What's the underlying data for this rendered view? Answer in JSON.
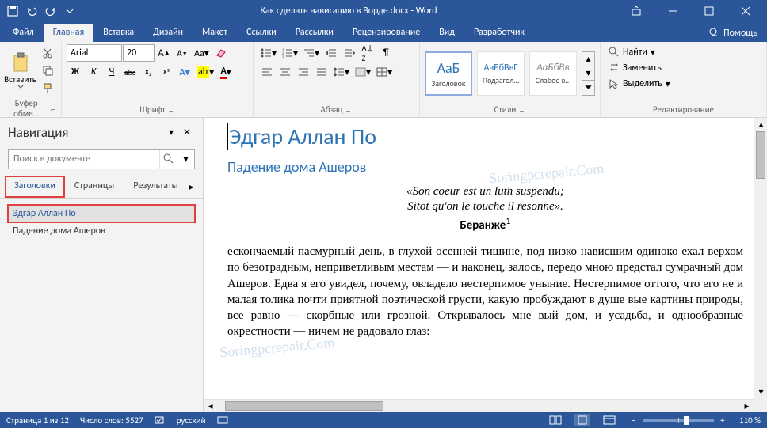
{
  "titlebar": {
    "doc_title": "Как сделать навигацию в Ворде.docx - Word"
  },
  "tabs": {
    "file": "Файл",
    "home": "Главная",
    "insert": "Вставка",
    "design": "Дизайн",
    "layout": "Макет",
    "references": "Ссылки",
    "mailings": "Рассылки",
    "review": "Рецензирование",
    "view": "Вид",
    "developer": "Разработчик",
    "help": "Помощь"
  },
  "ribbon": {
    "clipboard": {
      "paste": "Вставить",
      "label": "Буфер обме…"
    },
    "font": {
      "name": "Arial",
      "size": "20",
      "label": "Шрифт",
      "bold": "Ж",
      "italic": "К",
      "underline": "Ч",
      "strike": "abc"
    },
    "paragraph": {
      "label": "Абзац"
    },
    "styles": {
      "preview1": "АаБ",
      "name1": "Заголовок",
      "preview2": "АаБбВвГ",
      "name2": "Подзагол…",
      "preview3": "АаБбВв",
      "name3": "Слабое в…",
      "label": "Стили"
    },
    "editing": {
      "find": "Найти",
      "replace": "Заменить",
      "select": "Выделить",
      "label": "Редактирование"
    }
  },
  "nav": {
    "title": "Навигация",
    "search_placeholder": "Поиск в документе",
    "tabs": {
      "headings": "Заголовки",
      "pages": "Страницы",
      "results": "Результаты"
    },
    "items": {
      "0": "Эдгар Аллан По",
      "1": "Падение дома Ашеров"
    }
  },
  "doc": {
    "h1": "Эдгар Аллан По",
    "h2": "Падение дома Ашеров",
    "quote1": "«Son coeur est un luth suspendu;",
    "quote2": "Sitot qu'on le touche il resonne».",
    "attrib": "Беранже",
    "attrib_note": "1",
    "body": "ескончаемый пасмурный день, в глухой осенней тишине, под низко нависшим одиноко ехал верхом по безотрадным, неприветливым местам — и наконец, залось, передо мною предстал сумрачный дом Ашеров. Едва я его увидел, почему, овладело нестерпимое уныние. Нестерпимое оттого, что его не и малая толика почти приятной поэтической грусти, какую пробуждают в душе вые картины природы, все равно — скорбные или грозной. Открывалось мне вый дом, и усадьба, и однообразные окрестности — ничем не радовало глаз:"
  },
  "status": {
    "page": "Страница 1 из 12",
    "words": "Число слов: 5527",
    "lang": "русский",
    "zoom": "110 %"
  }
}
